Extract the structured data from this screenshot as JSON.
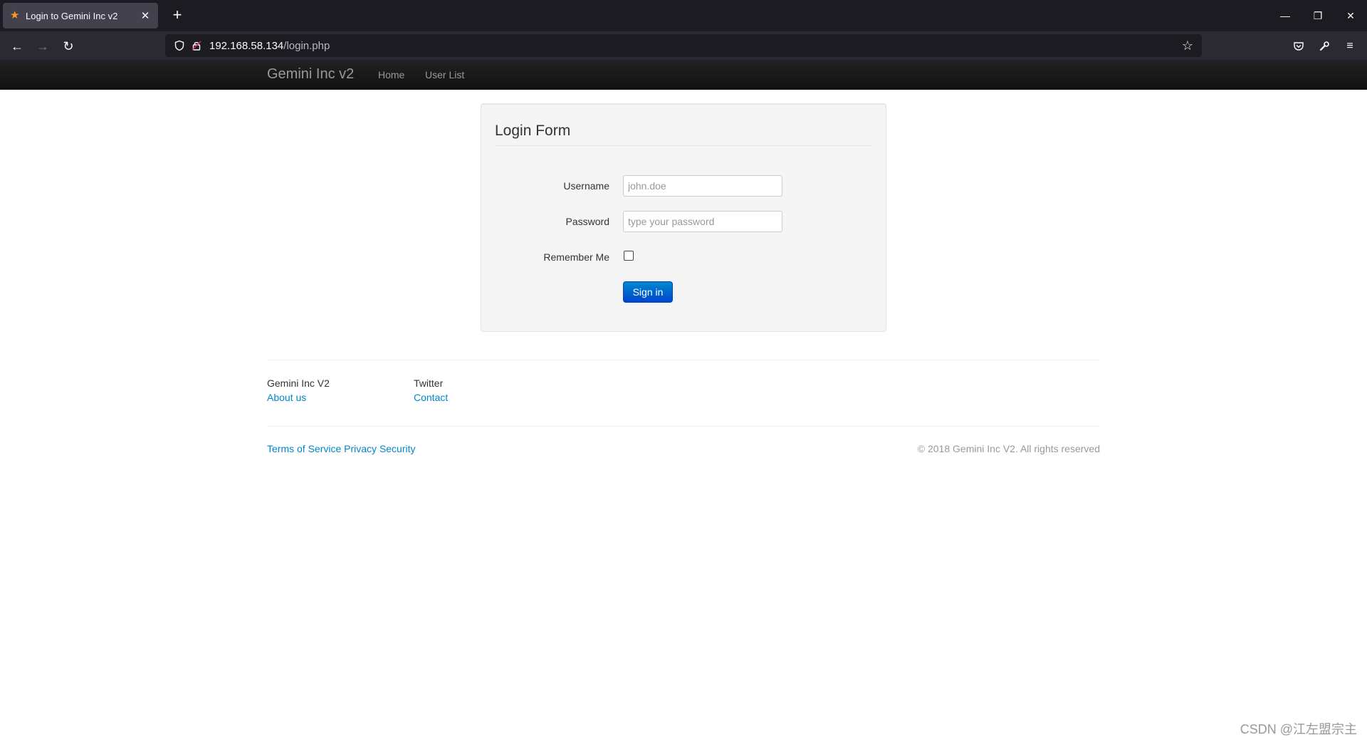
{
  "browser": {
    "tab_title": "Login to Gemini Inc v2",
    "url_host": "192.168.58.134",
    "url_path": "/login.php"
  },
  "site": {
    "brand": "Gemini Inc v2",
    "nav": [
      {
        "label": "Home"
      },
      {
        "label": "User List"
      }
    ]
  },
  "login": {
    "title": "Login Form",
    "username_label": "Username",
    "username_placeholder": "john.doe",
    "password_label": "Password",
    "password_placeholder": "type your password",
    "remember_label": "Remember Me",
    "submit_label": "Sign in"
  },
  "footer": {
    "col1_title": "Gemini Inc V2",
    "col1_link": "About us",
    "col2_title": "Twitter",
    "col2_link": "Contact",
    "links": [
      "Terms of Service",
      "Privacy",
      "Security"
    ],
    "copyright": "© 2018 Gemini Inc V2. All rights reserved"
  },
  "watermark": "CSDN @江左盟宗主",
  "colors": {
    "link": "#0088cc",
    "button": "#0044cc",
    "navbar": "#1b1b1b"
  }
}
